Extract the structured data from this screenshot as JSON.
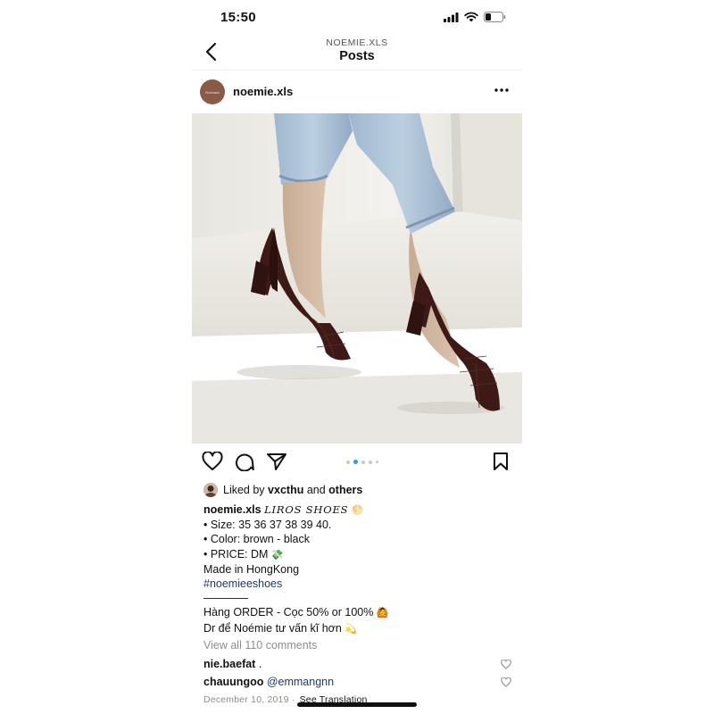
{
  "status_bar": {
    "time": "15:50"
  },
  "header": {
    "subtitle": "NOEMIE.XLS",
    "title": "Posts"
  },
  "post": {
    "avatar_text": "Noemie",
    "username": "noemie.xls"
  },
  "carousel": {
    "count": 5,
    "active_index": 1
  },
  "likes": {
    "prefix": "Liked by",
    "user": "vxcthu",
    "and": "and",
    "others": "others"
  },
  "caption": {
    "username": "noemie.xls",
    "brand": "LIROS SHOES",
    "lines": [
      "• Size: 35 36 37 38 39 40.",
      "• Color: brown - black",
      "• PRICE: DM",
      "Made in HongKong"
    ],
    "hashtag": "#noemieeshoes",
    "divider": "————",
    "order_line": "Hàng ORDER - Cọc 50% or 100%",
    "advice_line": "Dr để Noémie tư vấn kĩ hơn"
  },
  "view_comments": "View all 110 comments",
  "comments": [
    {
      "user": "nie.baefat",
      "text": "."
    },
    {
      "user": "chauungoo",
      "text": "@emmangnn"
    }
  ],
  "date": "December 10, 2019",
  "separator": "·",
  "see_translation": "See Translation",
  "icons": [
    "back-chevron-icon",
    "more-icon",
    "heart-icon",
    "comment-icon",
    "share-icon",
    "bookmark-icon",
    "signal-icon",
    "wifi-icon",
    "battery-icon"
  ]
}
